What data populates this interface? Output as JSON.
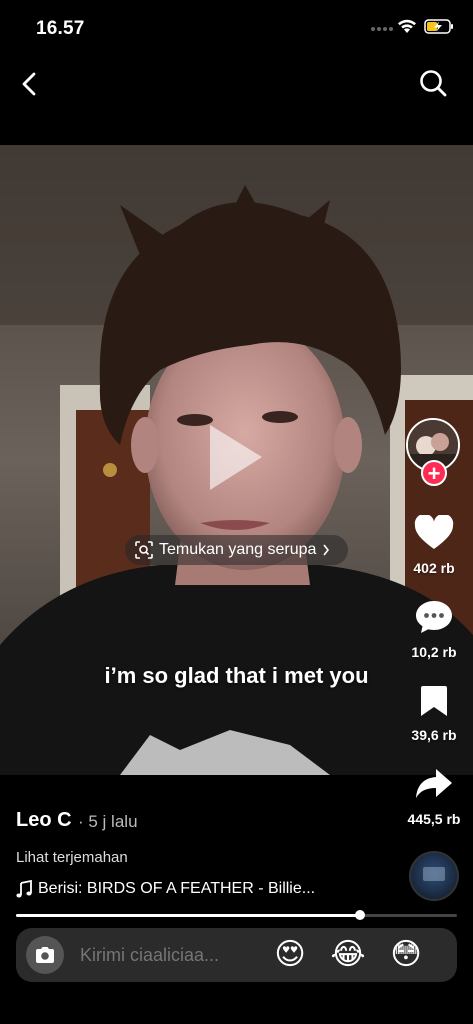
{
  "status_bar": {
    "time": "16.57"
  },
  "video": {
    "subtitle": "i’m so glad that i met you",
    "find_similar_label": "Temukan yang serupa"
  },
  "rail": {
    "likes": "402 rb",
    "comments": "10,2 rb",
    "saves": "39,6 rb",
    "shares": "445,5 rb",
    "follow_symbol": "+"
  },
  "post": {
    "author": "Leo C",
    "time_ago": "· 5 j lalu",
    "translate_label": "Lihat terjemahan",
    "music": "Berisi: BIRDS OF A FEATHER - Billie...",
    "progress_fraction": 0.78
  },
  "comment_bar": {
    "placeholder": "Kirimi ciaaliciaa...",
    "emojis": [
      "😍",
      "😂",
      "😳"
    ]
  },
  "colors": {
    "accent": "#fe2c55",
    "background": "#000000"
  }
}
